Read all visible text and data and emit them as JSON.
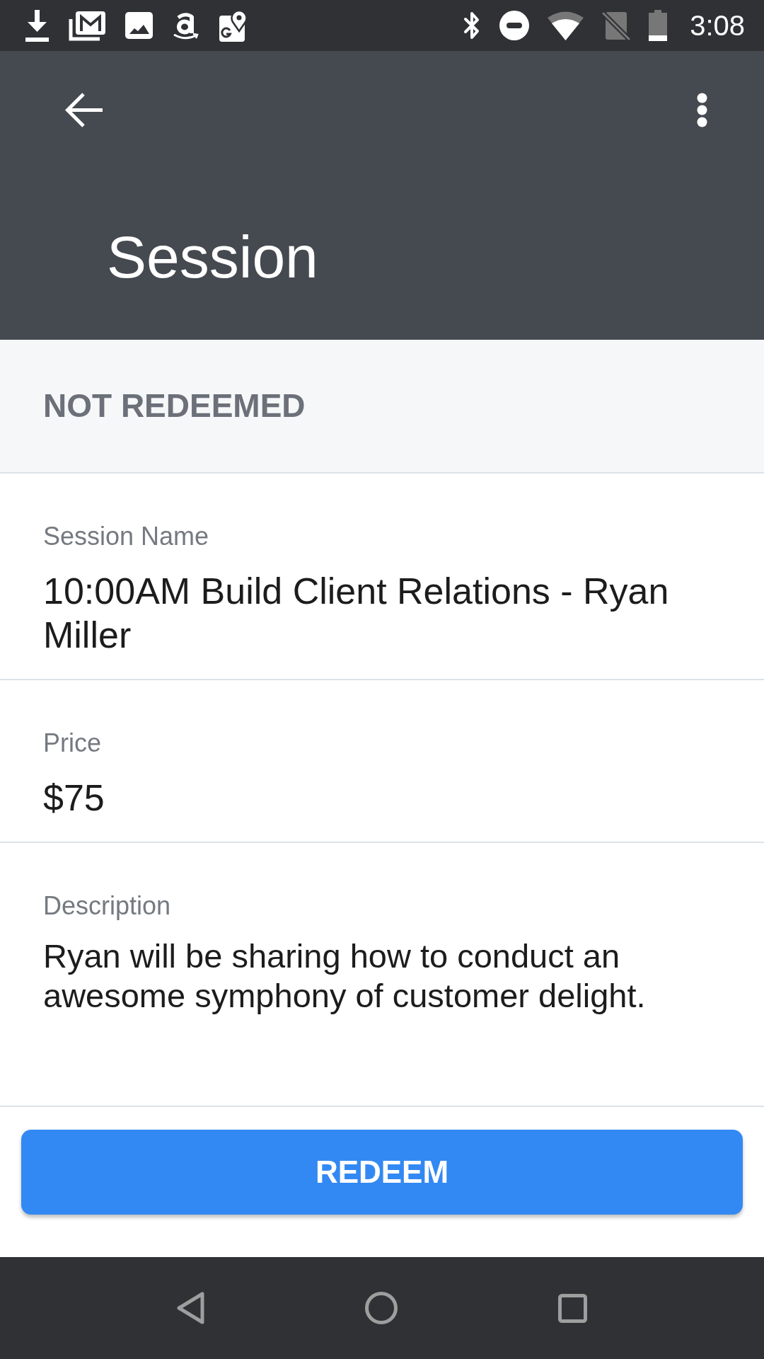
{
  "status_bar": {
    "time": "3:08"
  },
  "app_bar": {
    "title": "Session"
  },
  "status_header": {
    "text": "NOT REDEEMED"
  },
  "fields": [
    {
      "label": "Session Name",
      "value": "10:00AM Build Client Relations - Ryan Miller",
      "kind": "large"
    },
    {
      "label": "Price",
      "value": "$75",
      "kind": "large"
    },
    {
      "label": "Description",
      "value": "Ryan will be sharing how to conduct an awesome symphony of customer delight.",
      "kind": "body"
    }
  ],
  "action": {
    "label": "REDEEM"
  }
}
